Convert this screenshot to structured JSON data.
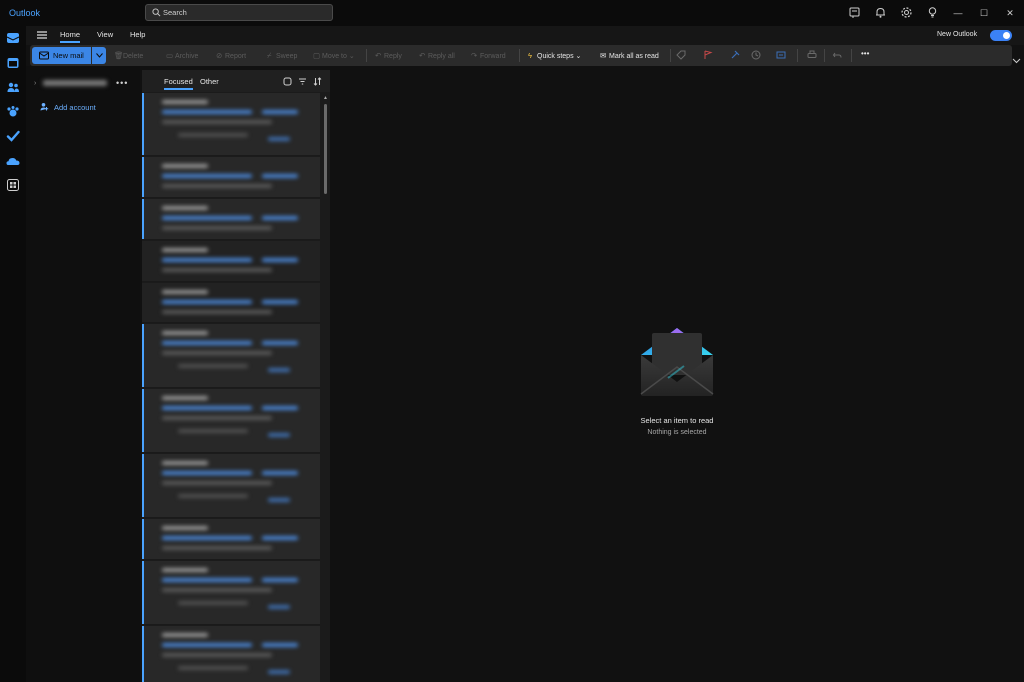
{
  "titlebar": {
    "app_title": "Outlook",
    "search_placeholder": "Search",
    "icons": [
      "notes-icon",
      "bell-icon",
      "gear-icon",
      "lightbulb-icon"
    ],
    "window_controls": [
      "minimize",
      "maximize",
      "close"
    ]
  },
  "menubar": {
    "items": [
      {
        "label": "Home",
        "active": true
      },
      {
        "label": "View",
        "active": false
      },
      {
        "label": "Help",
        "active": false
      }
    ],
    "new_outlook_label": "New Outlook",
    "new_outlook_enabled": true
  },
  "ribbon": {
    "new_mail": "New mail",
    "delete": "Delete",
    "archive": "Archive",
    "report": "Report",
    "sweep": "Sweep",
    "move_to": "Move to",
    "reply": "Reply",
    "reply_all": "Reply all",
    "forward": "Forward",
    "quick_steps": "Quick steps",
    "mark_all_read": "Mark all as read",
    "more": "•••"
  },
  "folder_pane": {
    "more": "•••",
    "add_account": "Add account"
  },
  "message_list": {
    "tabs": [
      {
        "label": "Focused",
        "active": true
      },
      {
        "label": "Other",
        "active": false
      }
    ]
  },
  "reading_pane": {
    "empty_title": "Select an item to read",
    "empty_subtitle": "Nothing is selected"
  },
  "colors": {
    "accent": "#4aa3ff",
    "primary_button": "#3b86e6",
    "background": "#111111"
  }
}
